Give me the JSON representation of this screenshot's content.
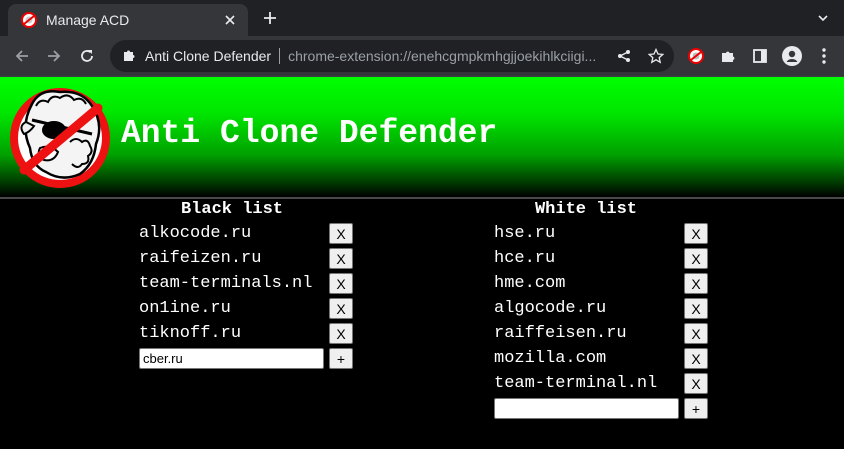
{
  "browser": {
    "tab_title": "Manage ACD",
    "omnibox_origin": "Anti Clone Defender",
    "omnibox_url": "chrome-extension://enehcgmpkmhgjjoekihlkciigi..."
  },
  "app": {
    "title": "Anti Clone Defender"
  },
  "black_list": {
    "title": "Black list",
    "items": [
      "alkocode.ru",
      "raifeizen.ru",
      "team-terminals.nl",
      "on1ine.ru",
      "tiknoff.ru"
    ],
    "remove_label": "X",
    "input_value": "cber.ru",
    "add_label": "+"
  },
  "white_list": {
    "title": "White list",
    "items": [
      "hse.ru",
      "hce.ru",
      "hme.com",
      "algocode.ru",
      "raiffeisen.ru",
      "mozilla.com",
      "team-terminal.nl"
    ],
    "remove_label": "X",
    "input_value": "",
    "add_label": "+"
  },
  "colors": {
    "banner_top": "#00ff00",
    "banner_bottom": "#000000",
    "page_bg": "#000000",
    "text": "#ffffff"
  },
  "icons": [
    "extension-favicon",
    "close-icon",
    "new-tab-icon",
    "tab-search-icon",
    "back-icon",
    "forward-icon",
    "reload-icon",
    "puzzle-icon",
    "share-icon",
    "star-icon",
    "side-panel-icon",
    "profile-icon",
    "kebab-menu-icon"
  ]
}
